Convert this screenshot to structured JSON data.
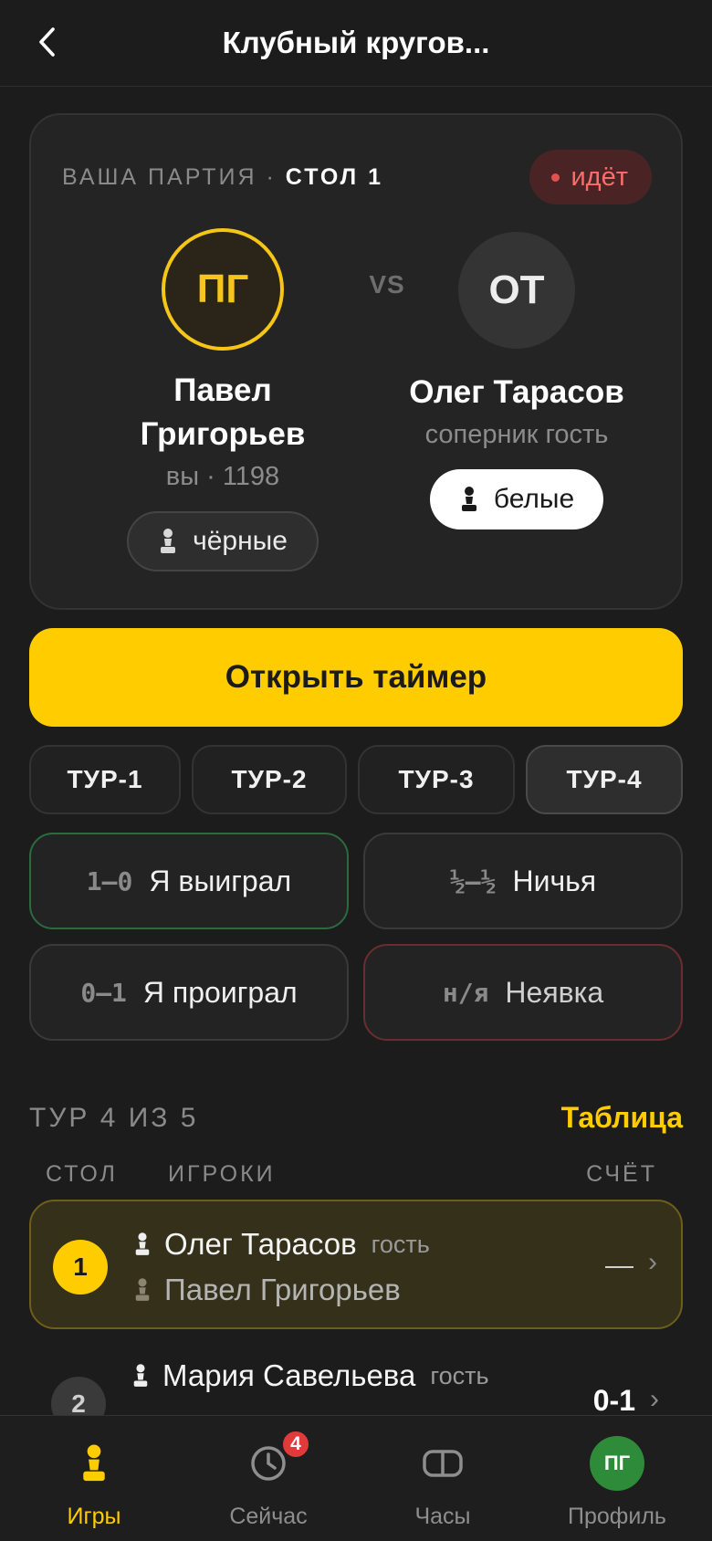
{
  "header": {
    "title": "Клубный кругов..."
  },
  "game_card": {
    "label": "ВАША ПАРТИЯ · ",
    "table_label": "СТОЛ 1",
    "status": "идёт",
    "vs": "VS",
    "me": {
      "initials": "ПГ",
      "name_line1": "Павел",
      "name_line2": "Григорьев",
      "subtitle": "вы · 1198",
      "color": "чёрные"
    },
    "opponent": {
      "initials": "ОТ",
      "name": "Олег Тарасов",
      "subtitle": "соперник гость",
      "color": "белые"
    }
  },
  "timer_button": "Открыть таймер",
  "rounds": [
    "ТУР-1",
    "ТУР-2",
    "ТУР-3",
    "ТУР-4"
  ],
  "active_round_index": 3,
  "results": {
    "win": {
      "code": "1–0",
      "label": "Я выиграл"
    },
    "draw": {
      "code": "½–½",
      "label": "Ничья"
    },
    "loss": {
      "code": "0–1",
      "label": "Я проиграл"
    },
    "noshow": {
      "code": "н/я",
      "label": "Неявка"
    }
  },
  "round_list": {
    "title": "ТУР 4 ИЗ 5",
    "table_link": "Таблица",
    "columns": {
      "table": "СТОЛ",
      "players": "ИГРОКИ",
      "score": "СЧЁТ"
    },
    "rows": [
      {
        "board": "1",
        "white": "Олег Тарасов",
        "white_tag": "гость",
        "black": "Павел Григорьев",
        "black_tag": "",
        "score": "—"
      },
      {
        "board": "2",
        "white": "Мария Савельева",
        "white_tag": "гость",
        "score": "0-1"
      }
    ]
  },
  "nav": {
    "games": "Игры",
    "now": "Сейчас",
    "now_badge": "4",
    "clock": "Часы",
    "profile": "Профиль",
    "profile_initials": "ПГ"
  },
  "colors": {
    "accent": "#ffcc00",
    "background": "#1c1c1c",
    "live": "#ff6a6a",
    "win_border": "#2c6a40",
    "noshow_border": "#6a2e2e"
  }
}
